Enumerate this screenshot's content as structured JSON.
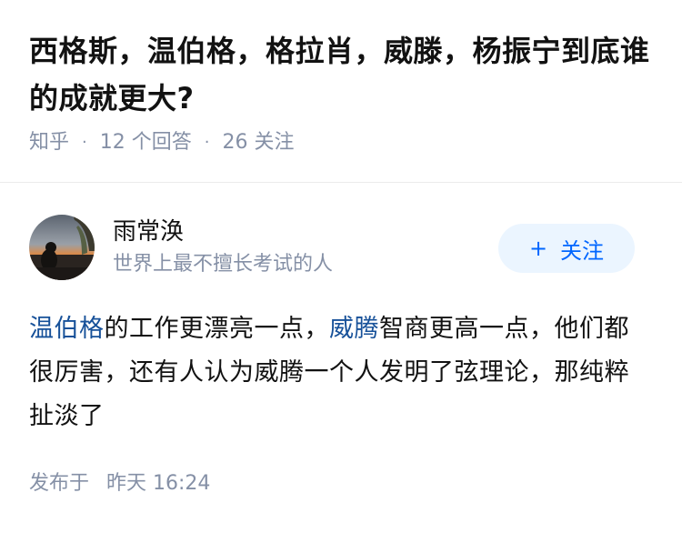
{
  "question": {
    "title": "西格斯，温伯格，格拉肖，威滕，杨振宁到底谁的成就更大?",
    "source": "知乎",
    "answer_count": "12 个回答",
    "follower_count": "26 关注"
  },
  "author": {
    "name": "雨常涣",
    "bio": "世界上最不擅长考试的人",
    "follow_label": "关注",
    "avatar_icon": "avatar-sunset-photo"
  },
  "answer": {
    "link1": "温伯格",
    "text1": "的工作更漂亮一点，",
    "link2": "威腾",
    "text2": "智商更高一点，他们都很厉害，还有人认为威腾一个人发明了弦理论，那纯粹扯淡了"
  },
  "footer": {
    "published_label": "发布于",
    "published_time": "昨天 16:24"
  },
  "colors": {
    "link": "#175199",
    "accent": "#0066ff",
    "follow_bg": "#ebf5ff",
    "meta": "#8590a6"
  }
}
